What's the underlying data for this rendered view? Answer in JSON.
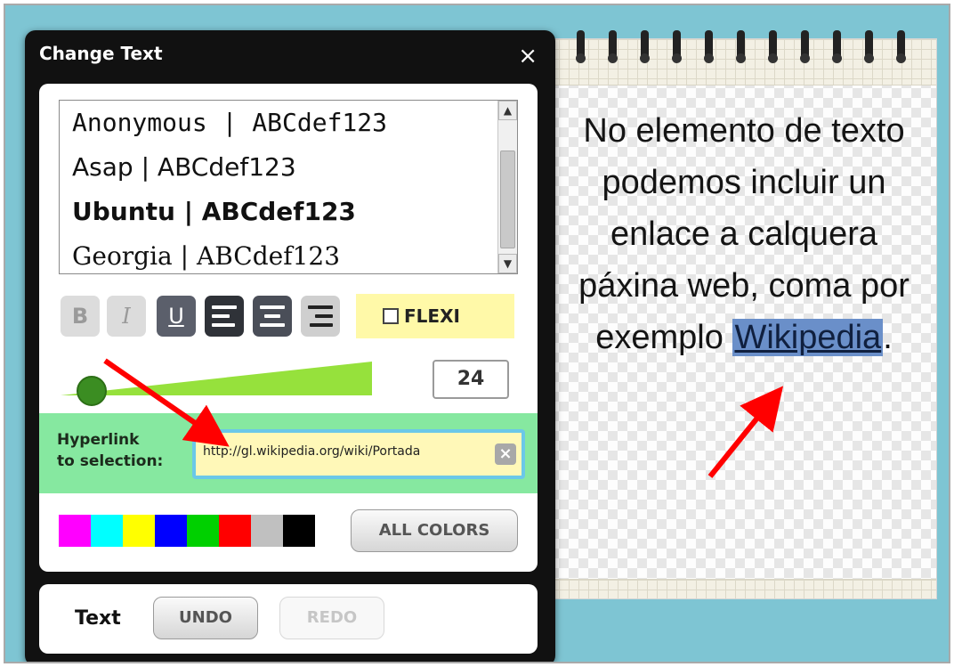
{
  "dialog": {
    "title": "Change Text",
    "close_icon": "×"
  },
  "fonts": {
    "items": [
      "Anonymous  |  ABCdef123",
      "Asap | ABCdef123",
      "Ubuntu | ABCdef123",
      "Georgia | ABCdef123"
    ],
    "scroll_up_icon": "▲",
    "scroll_down_icon": "▼"
  },
  "format": {
    "bold_label": "B",
    "italic_label": "I",
    "underline_label": "U",
    "underline_active": true,
    "alignment": "center",
    "flexi_label": "FLEXI",
    "flexi_checked": false
  },
  "size": {
    "value": "24"
  },
  "hyperlink": {
    "label_line1": "Hyperlink",
    "label_line2": "to selection:",
    "value": "http://gl.wikipedia.org/wiki/Portada",
    "clear_icon": "×"
  },
  "colors": {
    "swatches": [
      "#ff00ff",
      "#00ffff",
      "#ffff00",
      "#0000ff",
      "#00d000",
      "#ff0000",
      "#c0c0c0",
      "#000000"
    ],
    "all_colors_label": "ALL COLORS"
  },
  "history": {
    "label": "Text",
    "undo_label": "UNDO",
    "redo_label": "REDO"
  },
  "notebook": {
    "text_before": "No elemento de texto podemos incluir un enlace a calquera páxina web, coma por exemplo ",
    "link_text": "Wikipedia",
    "text_after": "."
  },
  "theme": {
    "background": "#7ec5d3",
    "link_row": "#86e8a0",
    "flexi_bg": "#fff9a8",
    "slider": "#96e13c",
    "arrow": "#ff0000"
  }
}
